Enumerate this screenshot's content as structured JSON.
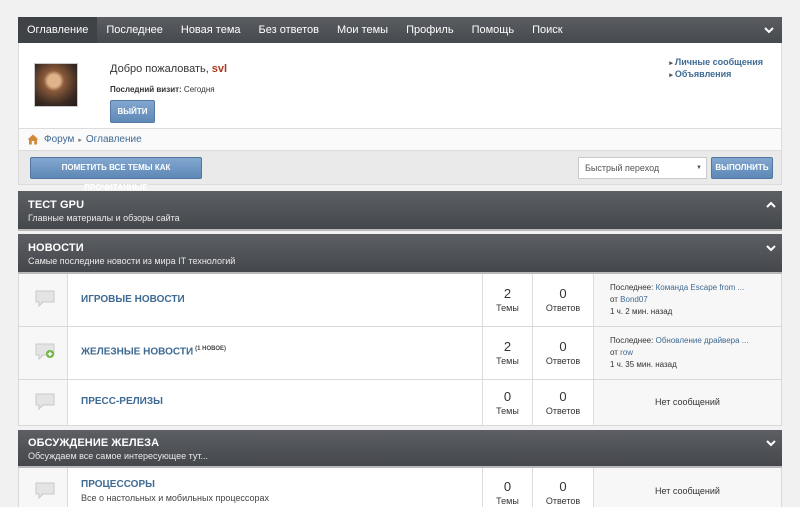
{
  "nav": {
    "items": [
      "Оглавление",
      "Последнее",
      "Новая тема",
      "Без ответов",
      "Мои темы",
      "Профиль",
      "Помощь",
      "Поиск"
    ],
    "active_index": 0
  },
  "welcome": {
    "greeting": "Добро пожаловать,",
    "username": "svl",
    "visit_label": "Последний визит:",
    "visit_value": "Сегодня",
    "logout_label": "ВЫЙТИ",
    "links": [
      "Личные сообщения",
      "Объявления"
    ]
  },
  "breadcrumb": {
    "items": [
      "Форум",
      "Оглавление"
    ]
  },
  "actions": {
    "mark_read_label": "ПОМЕТИТЬ ВСЕ ТЕМЫ КАК ПРОЧИТАННЫЕ",
    "quick_jump_value": "Быстрый переход",
    "go_label": "ВЫПОЛНИТЬ"
  },
  "labels": {
    "threads": "Темы",
    "posts": "Ответов",
    "last_prefix": "Последнее:",
    "by": "от",
    "no_posts": "Нет сообщений"
  },
  "categories": [
    {
      "title": "ТЕСТ GPU",
      "desc": "Главные материалы и обзоры сайта",
      "collapsed": true
    },
    {
      "title": "НОВОСТИ",
      "desc": "Самые последние новости из мира IT технологий",
      "collapsed": false
    },
    {
      "title": "ОБСУЖДЕНИЕ ЖЕЛЕЗА",
      "desc": "Обсуждаем все самое интересующее тут...",
      "collapsed": false
    }
  ],
  "forums": [
    {
      "title": "ИГРОВЫЕ НОВОСТИ",
      "sub": "",
      "badge": "",
      "threads": "2",
      "posts": "0",
      "last_title": "Команда Escape from ...",
      "last_user": "Bond07",
      "last_time": "1 ч. 2 мин. назад",
      "has_new": false
    },
    {
      "title": "ЖЕЛЕЗНЫЕ НОВОСТИ",
      "sub": "",
      "badge": "(1 НОВОЕ)",
      "threads": "2",
      "posts": "0",
      "last_title": "Обновление драйвера ...",
      "last_user": "row",
      "last_time": "1 ч. 35 мин. назад",
      "has_new": true
    },
    {
      "title": "ПРЕСС-РЕЛИЗЫ",
      "sub": "",
      "badge": "",
      "threads": "0",
      "posts": "0",
      "last_title": "",
      "last_user": "",
      "last_time": "",
      "has_new": false
    },
    {
      "title": "ПРОЦЕССОРЫ",
      "sub": "Все о настольных и мобильных процессорах",
      "badge": "",
      "threads": "0",
      "posts": "0",
      "last_title": "",
      "last_user": "",
      "last_time": "",
      "has_new": false
    }
  ],
  "colors": {
    "link": "#3e6a93",
    "username": "#b1361e",
    "nav_bg": "#4f5257",
    "button": "#6a91bd"
  }
}
